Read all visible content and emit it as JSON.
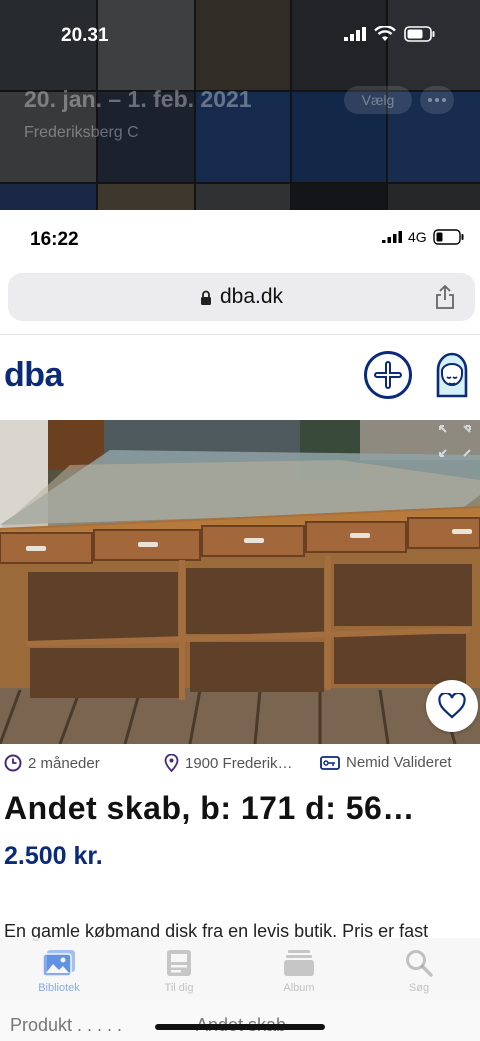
{
  "photos_app": {
    "status_time": "20.31",
    "date_range": "20. jan. – 1. feb. 2021",
    "location": "Frederiksberg C",
    "select_label": "Vælg",
    "tabs": [
      {
        "label": "Bibliotek",
        "icon": "photo-library-icon",
        "active": true
      },
      {
        "label": "Til dig",
        "icon": "for-you-icon",
        "active": false
      },
      {
        "label": "Album",
        "icon": "album-icon",
        "active": false
      },
      {
        "label": "Søg",
        "icon": "search-icon",
        "active": false
      }
    ]
  },
  "browser": {
    "status_time": "16:22",
    "network": "4G",
    "url": "dba.dk"
  },
  "site": {
    "logo": "dba",
    "brand_color": "#0b2a7a"
  },
  "listing": {
    "age": "2 måneder",
    "location": "1900 Frederik…",
    "verified": "Nemid Valideret",
    "title": "Andet skab, b: 171 d: 56…",
    "price": "2.500 kr.",
    "description": "En gamle købmand disk fra en levis butik. Pris er fast",
    "details": [
      {
        "label": "Produkt",
        "value": "Andet skab"
      }
    ]
  }
}
